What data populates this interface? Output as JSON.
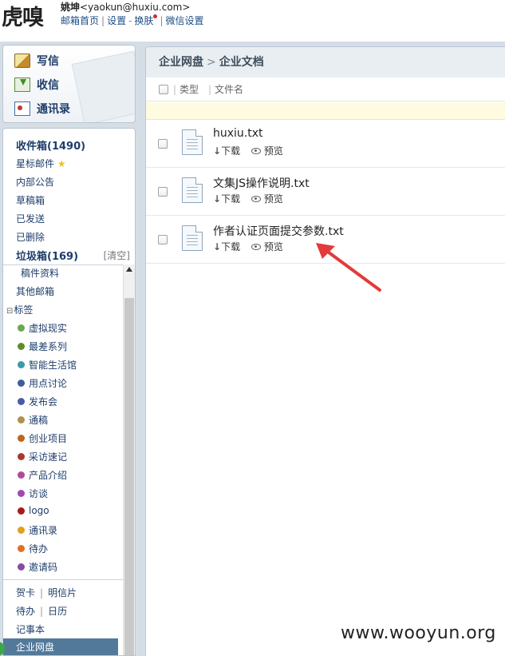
{
  "header": {
    "logo": "虎嗅",
    "user_name": "姚坤",
    "user_email": "<yaokun@huxiu.com>",
    "nav": {
      "home": "邮箱首页",
      "settings": "设置",
      "skin": "换肤",
      "wechat": "微信设置",
      "sep_bar": "|",
      "sep_dash": "-"
    }
  },
  "compose": {
    "write": "写信",
    "receive": "收信",
    "contacts": "通讯录"
  },
  "folders": {
    "inbox": "收件箱(1490)",
    "starred": "星标邮件",
    "star": "★",
    "notice": "内部公告",
    "drafts": "草稿箱",
    "sent": "已发送",
    "deleted": "已删除",
    "trash": "垃圾箱(169)",
    "clear": "[清空]",
    "attachments": "稿件资料",
    "other": "其他邮箱",
    "tags_head": "标签",
    "tag_toggle": "⊟"
  },
  "tags": [
    {
      "label": "虚拟现实",
      "color": "#6aa84f"
    },
    {
      "label": "最差系列",
      "color": "#5b8f2a"
    },
    {
      "label": "智能生活馆",
      "color": "#3a9aa6"
    },
    {
      "label": "用点讨论",
      "color": "#3e5f9a"
    },
    {
      "label": "发布会",
      "color": "#4a5aa8"
    },
    {
      "label": "通稿",
      "color": "#b0904a"
    },
    {
      "label": "创业项目",
      "color": "#c0641f"
    },
    {
      "label": "采访速记",
      "color": "#a83a2a"
    },
    {
      "label": "产品介绍",
      "color": "#b04a9a"
    },
    {
      "label": "访谈",
      "color": "#a04ab0"
    },
    {
      "label": "logo",
      "color": "#a81a1a"
    },
    {
      "label": "通讯录",
      "color": "#e0a020"
    },
    {
      "label": "待办",
      "color": "#e07020"
    },
    {
      "label": "邀请码",
      "color": "#8a4aa0"
    }
  ],
  "extras": {
    "card": "贺卡",
    "postcard": "明信片",
    "todo": "待办",
    "calendar": "日历",
    "notes": "记事本",
    "netdisk": "企业网盘",
    "sep": "|"
  },
  "breadcrumb": {
    "root": "企业网盘",
    "arrow": ">",
    "current": "企业文档"
  },
  "columns": {
    "type": "类型",
    "name": "文件名",
    "bar": "|"
  },
  "files": [
    {
      "name": "huxiu.txt",
      "download": "下载",
      "preview": "预览"
    },
    {
      "name": "文集JS操作说明.txt",
      "download": "下载",
      "preview": "预览"
    },
    {
      "name": "作者认证页面提交参数.txt",
      "download": "下载",
      "preview": "预览"
    }
  ],
  "watermark": "www.wooyun.org",
  "colors": {
    "accent": "#52799a",
    "link": "#1d4d86",
    "annotation_arrow": "#e23b3b"
  }
}
